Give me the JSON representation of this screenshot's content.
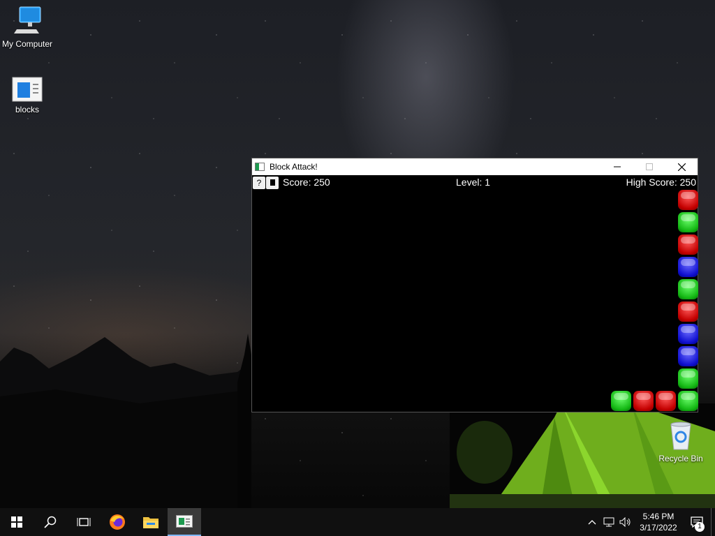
{
  "desktop": {
    "icons": [
      {
        "label": "My Computer",
        "icon": "computer-icon"
      },
      {
        "label": "blocks",
        "icon": "blocks-app-icon"
      },
      {
        "label": "Recycle Bin",
        "icon": "recycle-bin-icon"
      }
    ]
  },
  "window": {
    "title": "Block Attack!",
    "controls": {
      "minimize": "minimize-icon",
      "maximize": "maximize-icon",
      "close": "close-icon"
    },
    "toolbar": {
      "help_label": "?",
      "stop_icon": "stop-icon"
    },
    "hud": {
      "score": "Score: 250",
      "level": "Level: 1",
      "high_score": "High Score: 250"
    },
    "board": {
      "right_column": [
        "red",
        "green",
        "red",
        "blue",
        "green",
        "red",
        "blue",
        "blue",
        "green",
        "green"
      ],
      "bottom_row": [
        "green",
        "red",
        "red"
      ]
    }
  },
  "taskbar": {
    "items": [
      {
        "name": "start",
        "icon": "windows-icon"
      },
      {
        "name": "search",
        "icon": "search-icon"
      },
      {
        "name": "task-view",
        "icon": "task-view-icon"
      },
      {
        "name": "firefox",
        "icon": "firefox-icon"
      },
      {
        "name": "file-explorer",
        "icon": "folder-icon"
      },
      {
        "name": "block-attack",
        "icon": "blocks-app-icon",
        "active": true
      }
    ],
    "tray": {
      "icons": [
        "chevron-up-icon",
        "network-icon",
        "volume-icon"
      ],
      "time": "5:46 PM",
      "date": "3/17/2022",
      "notification_count": "1"
    }
  }
}
